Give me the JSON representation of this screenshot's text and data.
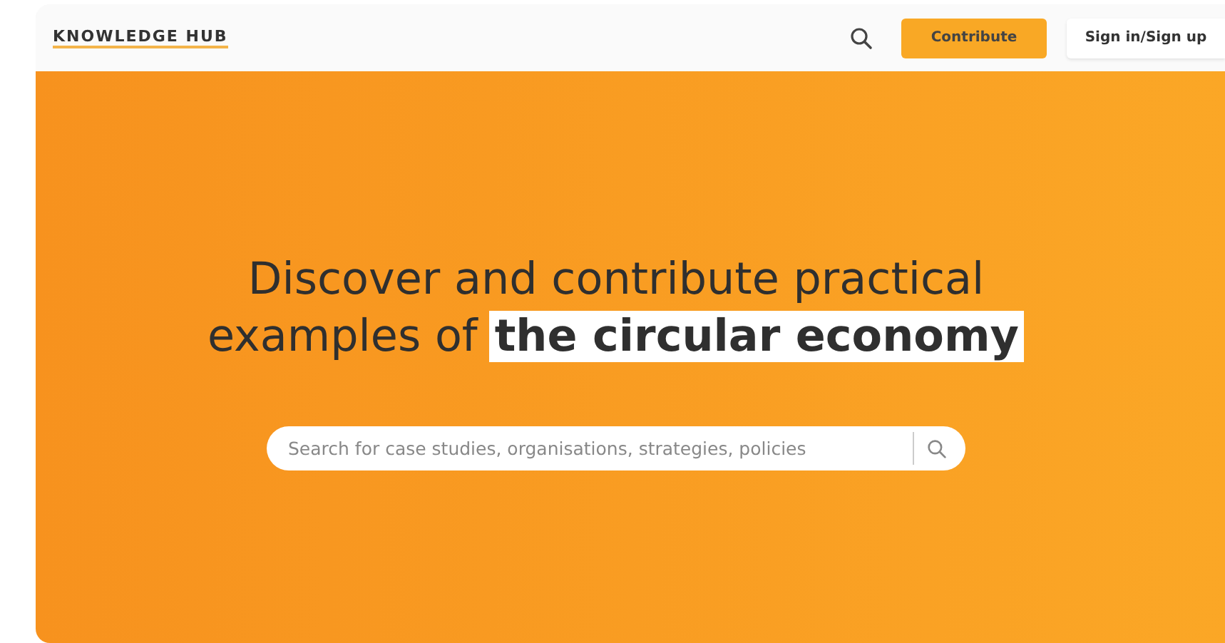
{
  "header": {
    "logo": "KNOWLEDGE HUB",
    "contribute_button": "Contribute",
    "sign_in_button": "Sign in/Sign up"
  },
  "hero": {
    "headline_line_1": "Discover and contribute practical",
    "headline_line_2": "examples of",
    "headline_highlight": "the circular economy",
    "search": {
      "placeholder": "Search for case studies, organisations, strategies, policies"
    }
  }
}
